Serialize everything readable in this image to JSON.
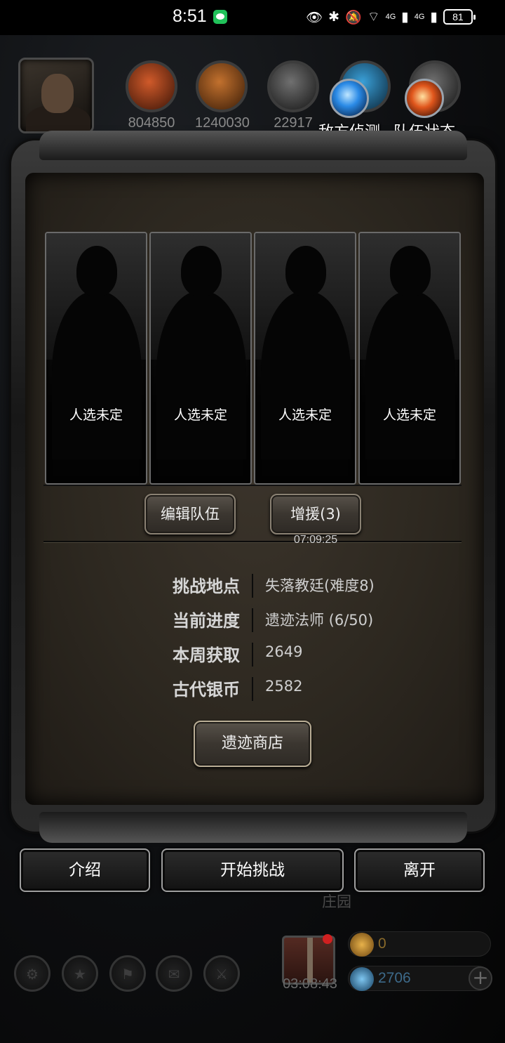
{
  "status_bar": {
    "time": "8:51",
    "network_1": "4G",
    "network_2": "4G",
    "battery": "81"
  },
  "resources": [
    {
      "name": "meat",
      "value": "804850"
    },
    {
      "name": "wood",
      "value": "1240030"
    },
    {
      "name": "iron",
      "value": "22917"
    }
  ],
  "hud_buttons": {
    "enemy_scout": "敌方侦测",
    "team_status": "队伍状态"
  },
  "team_slots": [
    {
      "label": "人选未定"
    },
    {
      "label": "人选未定"
    },
    {
      "label": "人选未定"
    },
    {
      "label": "人选未定"
    }
  ],
  "team_actions": {
    "edit_team": "编辑队伍",
    "reinforce": "增援(3)",
    "reinforce_timer": "07:09:25"
  },
  "info": [
    {
      "key": "挑战地点",
      "value": "失落教廷(难度8)"
    },
    {
      "key": "当前进度",
      "value": "遗迹法师 (6/50)"
    },
    {
      "key": "本周获取",
      "value": "2649"
    },
    {
      "key": "古代银币",
      "value": "2582"
    }
  ],
  "shop_button": "遗迹商店",
  "bottom_buttons": {
    "intro": "介绍",
    "start": "开始挑战",
    "leave": "离开"
  },
  "manor_label": "庄园",
  "gift_timer": "03:08:43",
  "currency": {
    "gold": "0",
    "gems": "2706"
  },
  "colors": {
    "background": "#0a0a0a",
    "parchment": "#2d2820",
    "frame": "#2a2a2a",
    "text_light": "#e8e8e8"
  }
}
